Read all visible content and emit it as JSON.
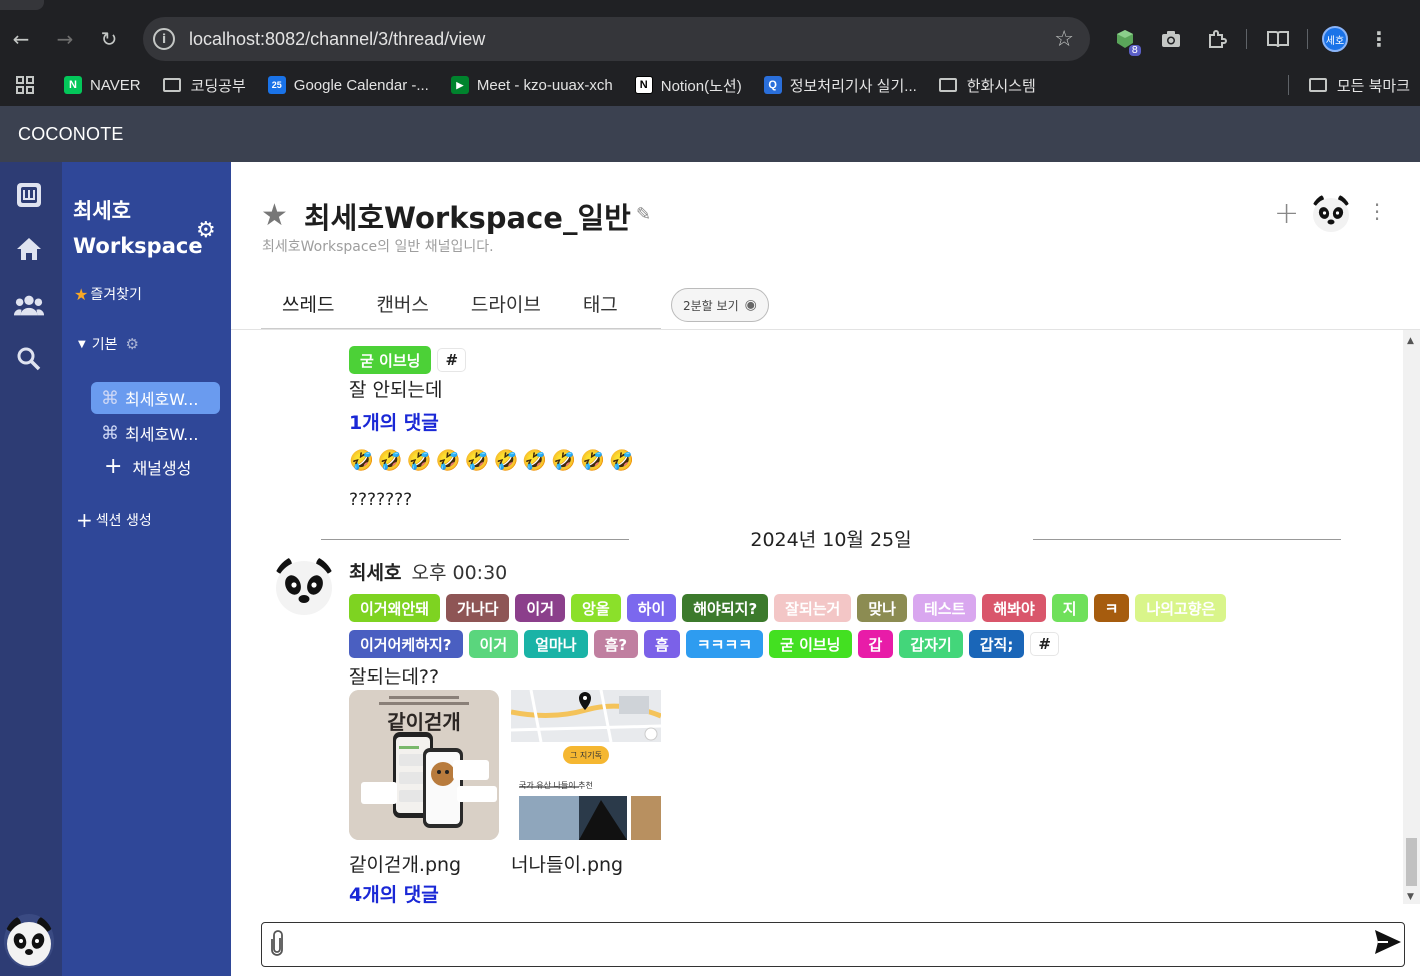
{
  "browser": {
    "url": "localhost:8082/channel/3/thread/view",
    "extension_badge": "8",
    "profile_label": "세호",
    "bookmarks": [
      {
        "label": "NAVER",
        "type": "site",
        "color": "#03c75a",
        "glyph": "N"
      },
      {
        "label": "코딩공부",
        "type": "folder"
      },
      {
        "label": "Google Calendar -...",
        "type": "site",
        "color": "#1a73e8",
        "glyph": "25"
      },
      {
        "label": "Meet - kzo-uuax-xch",
        "type": "site",
        "color": "#00832d",
        "glyph": "▶"
      },
      {
        "label": "Notion(노션)",
        "type": "site",
        "color": "#ffffff",
        "glyph": "N"
      },
      {
        "label": "정보처리기사 실기...",
        "type": "site",
        "color": "#2a6fdb",
        "glyph": "Q"
      },
      {
        "label": "한화시스템",
        "type": "folder"
      }
    ],
    "all_bookmarks": "모든 북마크"
  },
  "app": {
    "brand": "COCONOTE"
  },
  "sidebar": {
    "workspace_line1": "최세호",
    "workspace_line2": "Workspace",
    "favorites": "즐겨찾기",
    "section_name": "기본",
    "channels": [
      {
        "label": "최세호W...",
        "active": true
      },
      {
        "label": "최세호W...",
        "active": false
      }
    ],
    "add_channel": "채널생성",
    "add_section": "섹션 생성"
  },
  "channel": {
    "title": "최세호Workspace_일반",
    "description": "최세호Workspace의 일반 채널입니다.",
    "tabs": [
      "쓰레드",
      "캔버스",
      "드라이브",
      "태그"
    ],
    "split_view": "2분할 보기"
  },
  "feed": {
    "prev_tag": {
      "label": "굳 이브닝",
      "color": "#4cd137"
    },
    "prev_text": "잘 안되는데",
    "prev_comments": "1개의 댓글",
    "emojis": "🤣🤣🤣🤣🤣🤣🤣🤣🤣🤣",
    "question_line": "???????",
    "date": "2024년 10월 25일",
    "author": "최세호",
    "time": "오후 00:30",
    "tags_row1": [
      {
        "label": "이거왜안돼",
        "color": "#7ed321"
      },
      {
        "label": "가나다",
        "color": "#8e5555"
      },
      {
        "label": "이거",
        "color": "#8b3f8b"
      },
      {
        "label": "앙올",
        "color": "#8be02a"
      },
      {
        "label": "하이",
        "color": "#7b68ee"
      },
      {
        "label": "해야되지?",
        "color": "#3c7a2c"
      },
      {
        "label": "잘되는거",
        "color": "#f3c6c6"
      },
      {
        "label": "맞나",
        "color": "#8c8c52"
      },
      {
        "label": "테스트",
        "color": "#d9a7ef"
      },
      {
        "label": "해봐야",
        "color": "#d9566b"
      },
      {
        "label": "지",
        "color": "#6fe05b"
      },
      {
        "label": "ㅋ",
        "color": "#a65c0e"
      },
      {
        "label": "나의고향은",
        "color": "#d9f58a"
      }
    ],
    "tags_row2": [
      {
        "label": "이거어케하지?",
        "color": "#4a5fc1"
      },
      {
        "label": "이거",
        "color": "#5ad67d"
      },
      {
        "label": "얼마나",
        "color": "#1ab3a6"
      },
      {
        "label": "흠?",
        "color": "#c07fa0"
      },
      {
        "label": "흠",
        "color": "#7b61e8"
      },
      {
        "label": "ㅋㅋㅋㅋ",
        "color": "#2e9cf0"
      },
      {
        "label": "굳 이브닝",
        "color": "#43e021"
      },
      {
        "label": "갑",
        "color": "#e81ca8"
      },
      {
        "label": "갑자기",
        "color": "#43d67a"
      },
      {
        "label": "갑직;",
        "color": "#1a66b8"
      }
    ],
    "message": "잘되는데??",
    "files": [
      {
        "name": "같이걷개.png",
        "preview_title": "같이걷개"
      },
      {
        "name": "너나들이.png",
        "preview_badge": "그 지기독",
        "preview_caption": "국가 유산 나들이 추천"
      }
    ],
    "comments": "4개의 댓글"
  }
}
